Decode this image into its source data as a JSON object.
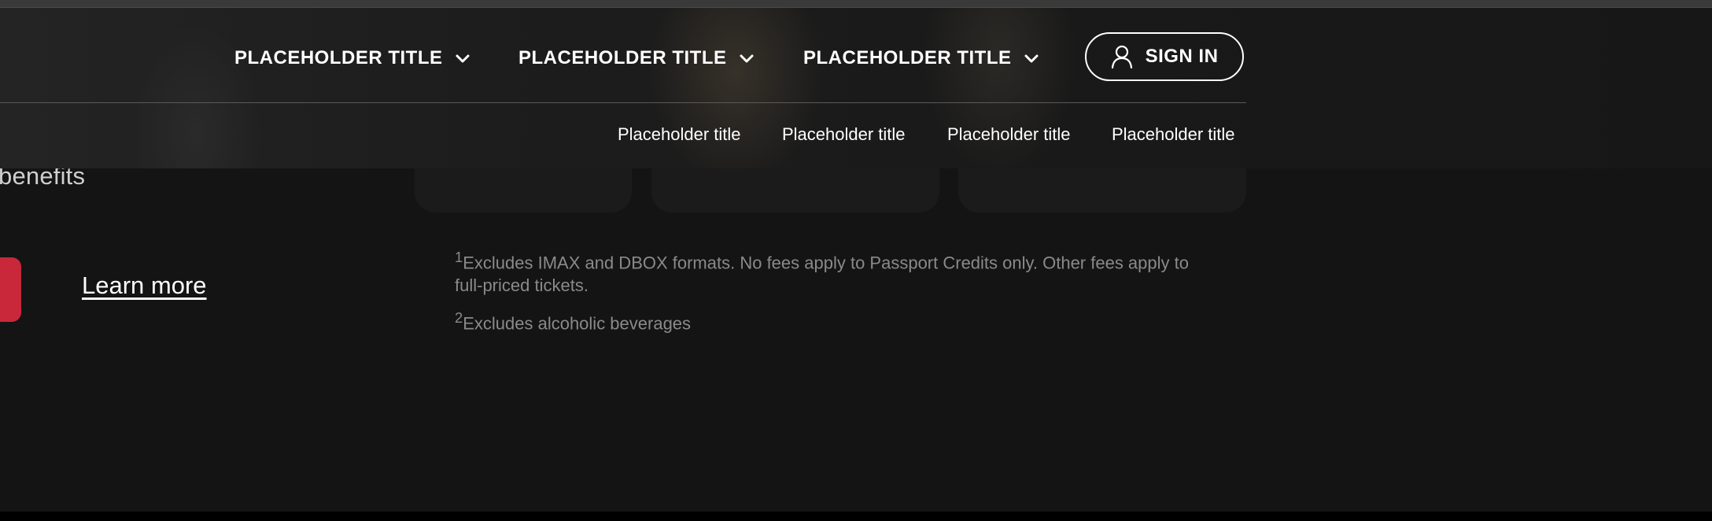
{
  "nav": {
    "items": [
      {
        "label": "PLACEHOLDER TITLE"
      },
      {
        "label": "PLACEHOLDER TITLE"
      },
      {
        "label": "PLACEHOLDER TITLE"
      }
    ],
    "sign_in_label": "SIGN IN",
    "sub_items": [
      {
        "label": "Placeholder title"
      },
      {
        "label": "Placeholder title"
      },
      {
        "label": "Placeholder title"
      },
      {
        "label": "Placeholder title"
      }
    ]
  },
  "promo": {
    "benefits_text": "benefits",
    "learn_more": "Learn more"
  },
  "footnotes": [
    {
      "marker": "1",
      "text": "Excludes IMAX and DBOX formats. No fees apply to Passport Credits only. Other fees apply to full‑priced tickets."
    },
    {
      "marker": "2",
      "text": "Excludes alcoholic beverages"
    }
  ],
  "colors": {
    "background": "#141414",
    "accent_red": "#c8283a",
    "footnote_text": "#8a8a8a"
  },
  "icons": {
    "nav_chevron": "chevron-down-icon",
    "sign_in": "user-icon"
  }
}
